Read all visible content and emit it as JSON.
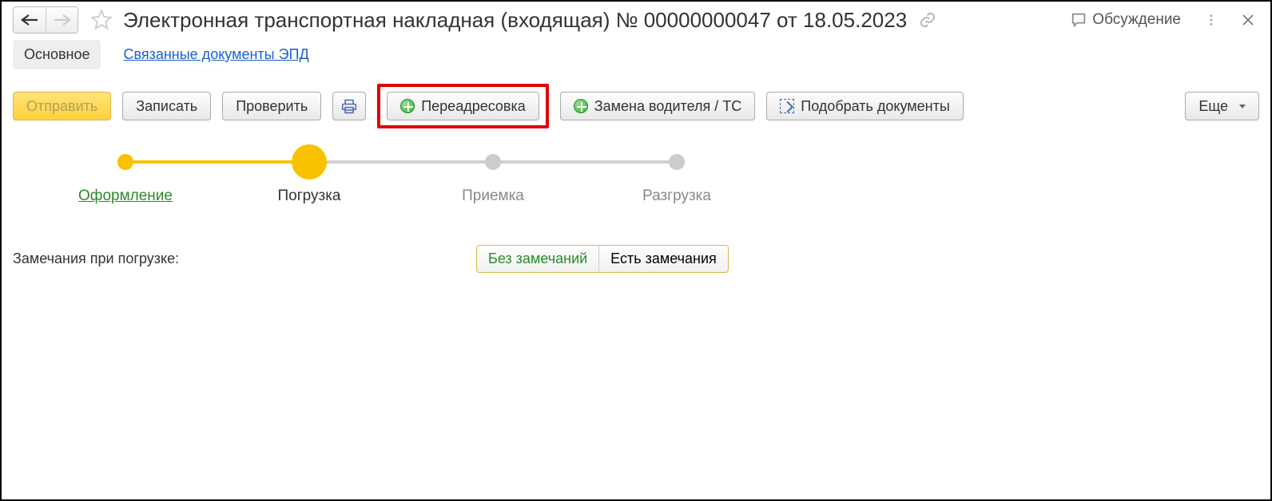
{
  "header": {
    "title": "Электронная транспортная накладная (входящая) № 00000000047 от 18.05.2023",
    "discuss": "Обсуждение"
  },
  "tabs": {
    "main": "Основное",
    "related": "Связанные документы ЭПД"
  },
  "toolbar": {
    "send": "Отправить",
    "save": "Записать",
    "check": "Проверить",
    "readdress": "Переадресовка",
    "replace_driver": "Замена водителя / ТС",
    "pick_docs": "Подобрать документы",
    "more": "Еще"
  },
  "steps": [
    {
      "label": "Оформление",
      "state": "done"
    },
    {
      "label": "Погрузка",
      "state": "current"
    },
    {
      "label": "Приемка",
      "state": "pending"
    },
    {
      "label": "Разгрузка",
      "state": "pending"
    }
  ],
  "form": {
    "remarks_label": "Замечания при погрузке:",
    "no_remarks": "Без замечаний",
    "has_remarks": "Есть замечания"
  }
}
